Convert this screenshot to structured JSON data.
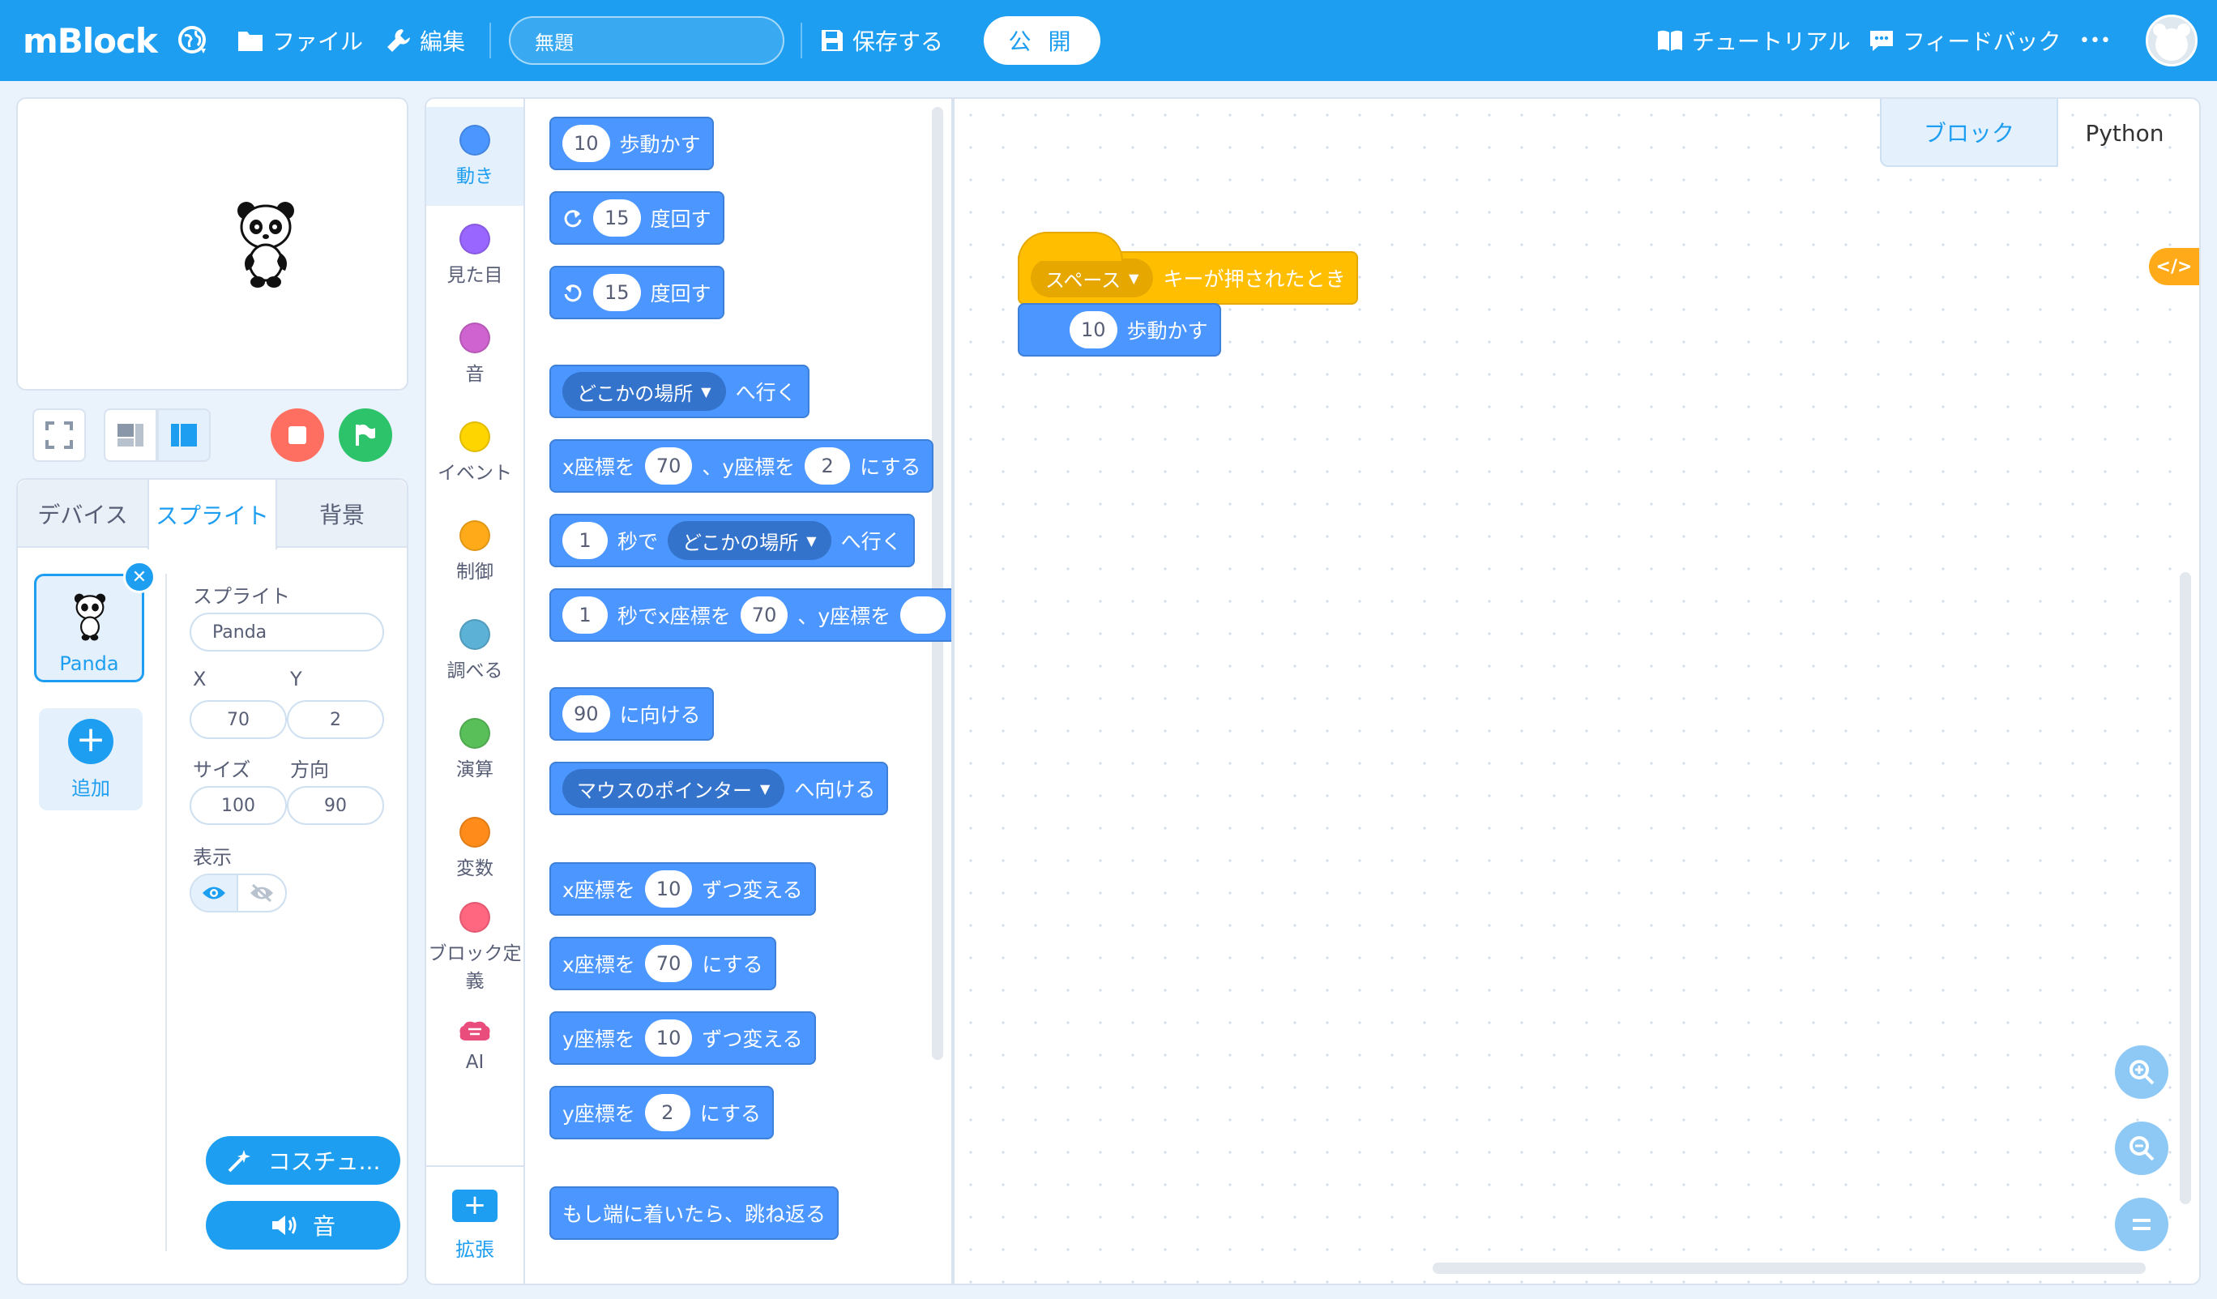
{
  "app": {
    "logo": "mBlock"
  },
  "menu": {
    "file": "ファイル",
    "edit": "編集",
    "save": "保存する",
    "publish": "公 開",
    "tutorial": "チュートリアル",
    "feedback": "フィードバック",
    "more": "•••"
  },
  "project": {
    "title": "無題"
  },
  "sprite_tabs": {
    "device": "デバイス",
    "sprite": "スプライト",
    "background": "背景"
  },
  "sprite": {
    "thumb_label": "Panda",
    "add_label": "追加",
    "section_label": "スプライト",
    "name": "Panda",
    "x_label": "X",
    "y_label": "Y",
    "x": "70",
    "y": "2",
    "size_label": "サイズ",
    "direction_label": "方向",
    "size": "100",
    "direction": "90",
    "show_label": "表示",
    "costume_button": "コスチュ...",
    "sound_button": "音"
  },
  "categories": [
    {
      "label": "動き",
      "color": "#4c97ff"
    },
    {
      "label": "見た目",
      "color": "#9966ff"
    },
    {
      "label": "音",
      "color": "#cf63cf"
    },
    {
      "label": "イベント",
      "color": "#ffd500"
    },
    {
      "label": "制御",
      "color": "#ffab19"
    },
    {
      "label": "調べる",
      "color": "#5cb1d6"
    },
    {
      "label": "演算",
      "color": "#59c059"
    },
    {
      "label": "変数",
      "color": "#ff8c1a"
    },
    {
      "label": "ブロック定義",
      "color": "#ff6680"
    },
    {
      "label": "AI",
      "color": "#e84d7c"
    }
  ],
  "extension_label": "拡張",
  "palette": {
    "move": {
      "v": "10",
      "t": "歩動かす"
    },
    "turn_right": {
      "v": "15",
      "t": "度回す"
    },
    "turn_left": {
      "v": "15",
      "t": "度回す"
    },
    "goto": {
      "dd": "どこかの場所",
      "t": "へ行く"
    },
    "goto_xy": {
      "t1": "x座標を",
      "x": "70",
      "t2": "、y座標を",
      "y": "2",
      "t3": "にする"
    },
    "glide": {
      "v": "1",
      "t1": "秒で",
      "dd": "どこかの場所",
      "t2": "へ行く"
    },
    "glide_xy": {
      "v": "1",
      "t1": "秒でx座標を",
      "x": "70",
      "t2": "、y座標を"
    },
    "point_dir": {
      "v": "90",
      "t": "に向ける"
    },
    "point_towards": {
      "dd": "マウスのポインター",
      "t": "へ向ける"
    },
    "change_x": {
      "t1": "x座標を",
      "v": "10",
      "t2": "ずつ変える"
    },
    "set_x": {
      "t1": "x座標を",
      "v": "70",
      "t2": "にする"
    },
    "change_y": {
      "t1": "y座標を",
      "v": "10",
      "t2": "ずつ変える"
    },
    "set_y": {
      "t1": "y座標を",
      "v": "2",
      "t2": "にする"
    },
    "bounce": {
      "t": "もし端に着いたら、跳ね返る"
    }
  },
  "workspace_tabs": {
    "blocks": "ブロック",
    "python": "Python"
  },
  "script": {
    "hat": {
      "dd": "スペース",
      "t": "キーが押されたとき"
    },
    "move": {
      "v": "10",
      "t": "歩動かす"
    }
  },
  "colors": {
    "topbar": "#1e9ef0",
    "motion": "#4c97ff",
    "events": "#ffbf00"
  }
}
